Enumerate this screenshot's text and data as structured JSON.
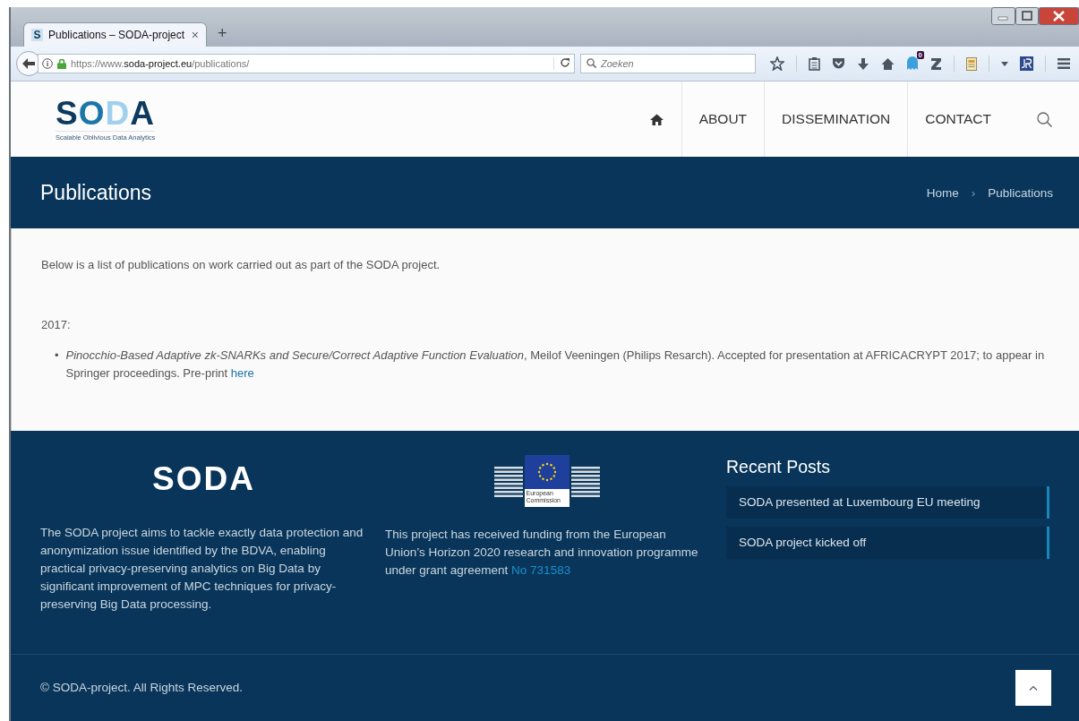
{
  "browser": {
    "tab": {
      "favicon": "S",
      "title": "Publications – SODA-project",
      "close": "×"
    },
    "new_tab": "+",
    "address": {
      "scheme": "https://www.",
      "host": "soda-project.eu",
      "path": "/publications/"
    },
    "search": {
      "placeholder": "Zoeken"
    },
    "badge": "0"
  },
  "header": {
    "logo": {
      "text": "SODA",
      "tagline": "Scalable Oblivious Data Analytics"
    },
    "nav": [
      {
        "label": "ABOUT"
      },
      {
        "label": "DISSEMINATION"
      },
      {
        "label": "CONTACT"
      }
    ]
  },
  "title_bar": {
    "title": "Publications",
    "separator": "›",
    "breadcrumb": [
      {
        "label": "Home"
      },
      {
        "label": "Publications"
      }
    ]
  },
  "content": {
    "intro": "Below is a list of publications on work carried out as part of the SODA project.",
    "sections": [
      {
        "year": "2017:",
        "items": [
          {
            "bullet": "•",
            "text": "*Pinocchio-Based Adaptive zk-SNARKs and Secure/Correct Adaptive Function Evaluation*, Meilof Veeningen (Philips Resarch). Accepted for presentation at AFRICACRYPT 2017; to appear in Springer proceedings. Pre-print ",
            "link": "here"
          }
        ]
      }
    ]
  },
  "footer": {
    "about": {
      "logo": "SODA",
      "text": "The SODA project aims to tackle exactly data protection and anonymization issue identified by the BDVA, enabling practical privacy-preserving analytics on Big Data by significant improvement of MPC techniques for privacy-preserving Big Data processing."
    },
    "funding": {
      "emblem_label": "European Commission",
      "text": "This project has received funding from the European Union’s Horizon 2020 research and innovation programme under grant agreement ",
      "link": "No 731583"
    },
    "recent_posts": {
      "heading": "Recent Posts",
      "posts": [
        {
          "title": "SODA presented at Luxembourg EU meeting"
        },
        {
          "title": "SODA project kicked off"
        }
      ]
    }
  },
  "bottom_bar": {
    "copyright": "© SODA-project. All Rights Reserved."
  }
}
